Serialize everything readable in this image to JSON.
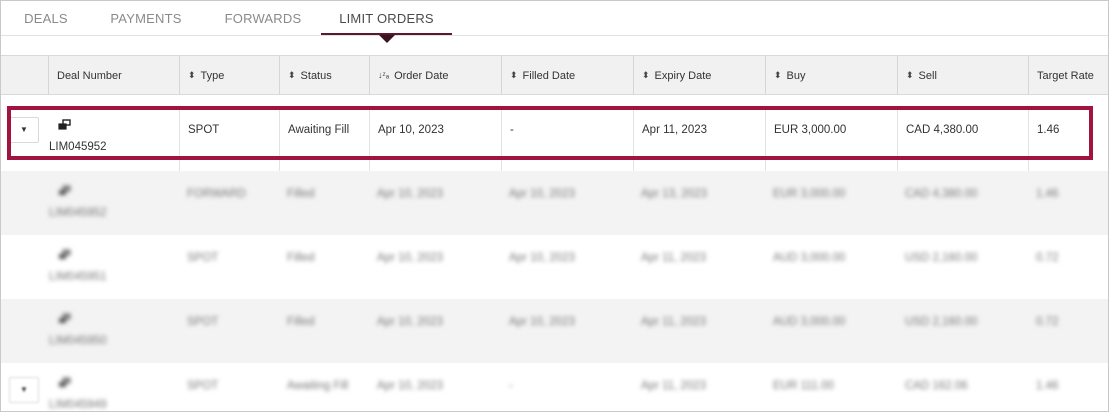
{
  "tabs": [
    {
      "label": "DEALS"
    },
    {
      "label": "PAYMENTS"
    },
    {
      "label": "FORWARDS"
    },
    {
      "label": "LIMIT ORDERS",
      "active": true
    }
  ],
  "columns": {
    "deal_number": "Deal Number",
    "type": "Type",
    "status": "Status",
    "order_date": "Order Date",
    "filled_date": "Filled Date",
    "expiry_date": "Expiry Date",
    "buy": "Buy",
    "sell": "Sell",
    "target_rate": "Target Rate"
  },
  "rows": [
    {
      "deal": "LIM045952",
      "type": "SPOT",
      "status": "Awaiting Fill",
      "order_date": "Apr 10, 2023",
      "filled_date": "-",
      "expiry_date": "Apr 11, 2023",
      "buy": "EUR 3,000.00",
      "sell": "CAD 4,380.00",
      "rate": "1.46",
      "expander": "▼"
    },
    {
      "deal": "LIM045952",
      "type": "FORWARD",
      "status": "Filled",
      "order_date": "Apr 10, 2023",
      "filled_date": "Apr 10, 2023",
      "expiry_date": "Apr 13, 2023",
      "buy": "EUR 3,000.00",
      "sell": "CAD 4,380.00",
      "rate": "1.46"
    },
    {
      "deal": "LIM045951",
      "type": "SPOT",
      "status": "Filled",
      "order_date": "Apr 10, 2023",
      "filled_date": "Apr 10, 2023",
      "expiry_date": "Apr 11, 2023",
      "buy": "AUD 3,000.00",
      "sell": "USD 2,160.00",
      "rate": "0.72"
    },
    {
      "deal": "LIM045950",
      "type": "SPOT",
      "status": "Filled",
      "order_date": "Apr 10, 2023",
      "filled_date": "Apr 10, 2023",
      "expiry_date": "Apr 11, 2023",
      "buy": "AUD 3,000.00",
      "sell": "USD 2,160.00",
      "rate": "0.72"
    },
    {
      "deal": "LIM045949",
      "type": "SPOT",
      "status": "Awaiting Fill",
      "order_date": "Apr 10, 2023",
      "filled_date": "-",
      "expiry_date": "Apr 11, 2023",
      "buy": "EUR 111.00",
      "sell": "CAD 162.06",
      "rate": "1.46",
      "expander": "▼"
    }
  ],
  "colors": {
    "accent": "#5a1a2c",
    "highlight": "#a0143f"
  }
}
